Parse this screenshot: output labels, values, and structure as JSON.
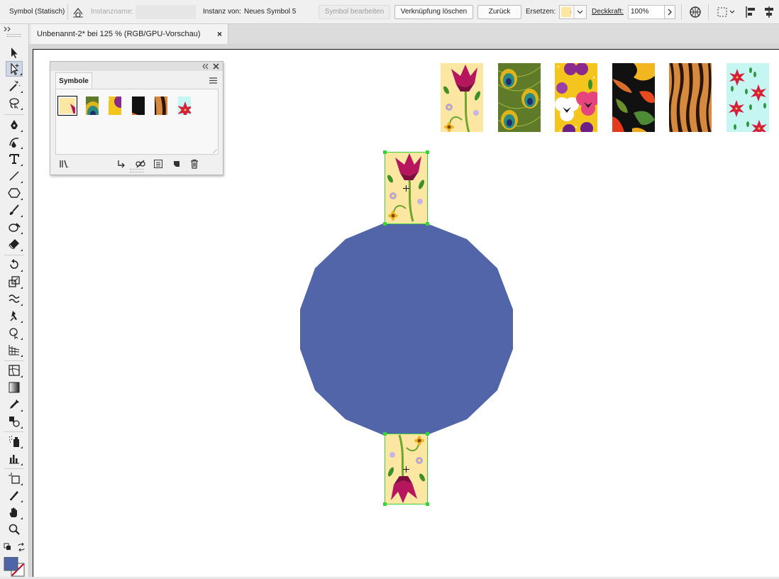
{
  "control_bar": {
    "object_type": "Symbol (Statisch)",
    "instance_name_label": "Instanzname:",
    "instance_name_value": "",
    "instance_of_label": "Instanz von:",
    "instance_of_value": "Neues Symbol 5",
    "edit_symbol_label": "Symbol bearbeiten",
    "break_link_label": "Verknüpfung löschen",
    "reset_label": "Zurück",
    "replace_label": "Ersetzen:",
    "opacity_label": "Deckkraft:",
    "opacity_value": "100%"
  },
  "document_tab": {
    "title": "Unbenannt-2* bei 125 % (RGB/GPU-Vorschau)",
    "close_glyph": "×"
  },
  "symbols_panel": {
    "title": "Symbole",
    "swatches": [
      "lilie",
      "pfau",
      "stiefmuetterchen",
      "blaetter",
      "tiger",
      "weihnachtsstern"
    ],
    "selected_index": 0
  },
  "canvas": {
    "shape_color": "#5165a8",
    "selection_color": "#3ad23a",
    "patterns": [
      "lilie",
      "pfau",
      "stiefmuetterchen",
      "blaetter",
      "tiger",
      "weihnachtsstern"
    ]
  },
  "colors": {
    "fill": "#4e66a5",
    "accent_selection": "#3ad23a"
  }
}
